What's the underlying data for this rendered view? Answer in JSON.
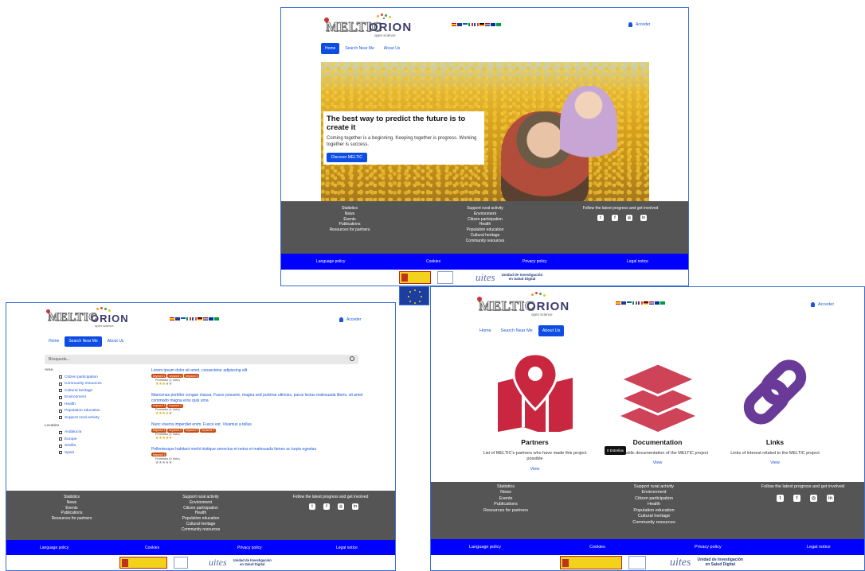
{
  "brand": {
    "meltic": "MELTIC",
    "orion": "ORION",
    "orion_sub": "open science"
  },
  "header": {
    "login_label": "Acceder",
    "login_icon": "user-icon"
  },
  "nav": {
    "home": "Home",
    "search": "Search Near Me",
    "about": "About Us"
  },
  "hero": {
    "title": "The best way to predict the future is to create it",
    "text": "Coming together is a beginning. Keeping together is progress. Working together is success.",
    "button": "Discover MELTIC"
  },
  "footer": {
    "links": [
      "Statistics",
      "News",
      "Events",
      "Publications",
      "Resources for partners"
    ],
    "areas": [
      "Support rural activity",
      "Environment",
      "Citizen participation",
      "Health",
      "Population education",
      "Cultural heritage",
      "Community resources"
    ],
    "follow": "Follow the latest progress and get involved",
    "social": [
      "twitter-icon",
      "facebook-icon",
      "instagram-icon",
      "linkedin-icon"
    ]
  },
  "policy_bar": {
    "language": "Language policy",
    "cookies": "Cookies",
    "privacy": "Privacy policy",
    "legal": "Legal notice"
  },
  "sponsors": {
    "uites": "uites",
    "unit_line1": "Unidad de Investigación",
    "unit_line2": "en Salud Digital"
  },
  "search_page": {
    "placeholder": "Búsqueda...",
    "area_label": "Area",
    "areas": [
      "Citizen participation",
      "Community resources",
      "Cultural heritage",
      "Environment",
      "Health",
      "Population education",
      "Support rural activity"
    ],
    "location_label": "Location",
    "locations": [
      "Andalucía",
      "Europe",
      "Sevilla",
      "Spain"
    ],
    "results": [
      {
        "title": "Lorem ipsum dolor sit amet, consectetur adipiscing elit",
        "keywords": [
          "keyword 1",
          "keyword 2",
          "keyword 3"
        ],
        "avg": "Promedio (1 Voto)",
        "rating": 3
      },
      {
        "title": "Maecenas porttitor congue massa. Fusce posuere, magna sed pulvinar ultricies, purus lectus malesuada libero, sit amet commodo magna eros quis urna",
        "keywords": [
          "keyword 1",
          "keyword 2"
        ],
        "avg": "Promedio (1 Voto)",
        "rating": 4
      },
      {
        "title": "Nunc viverra imperdiet enim. Fusce est. Vivamus a tellus",
        "keywords": [
          "keyword 1",
          "keyword 2",
          "keyword 3",
          "keyword 4"
        ],
        "avg": "Promedio (1 Voto)",
        "rating": 5
      },
      {
        "title": "Pellentesque habitant morbi tristique senectus et netus et malesuada fames ac turpis egestas",
        "keywords": [
          "keyword 1"
        ],
        "avg": "Promedio (0 Voto)",
        "rating": 0
      }
    ]
  },
  "about_page": {
    "cards": [
      {
        "title": "Partners",
        "desc": "List of MELTIC's partners who have made this project possible",
        "link": "View",
        "icon": "map-pin-icon",
        "color": "#c8273f"
      },
      {
        "title": "Documentation",
        "desc": "Related public documentation of the MELTIC project",
        "link": "View",
        "icon": "layers-icon",
        "color": "#cf4359"
      },
      {
        "title": "Links",
        "desc": "Links of interest related to the MELTIC project",
        "link": "View",
        "icon": "link-icon",
        "color": "#6a3a99"
      }
    ],
    "tooltip": "0 Estrellas"
  },
  "colors": {
    "primary": "#0d4de4",
    "footer": "#555555",
    "policy_bar": "#0000ff",
    "keyword": "#c84b10"
  }
}
